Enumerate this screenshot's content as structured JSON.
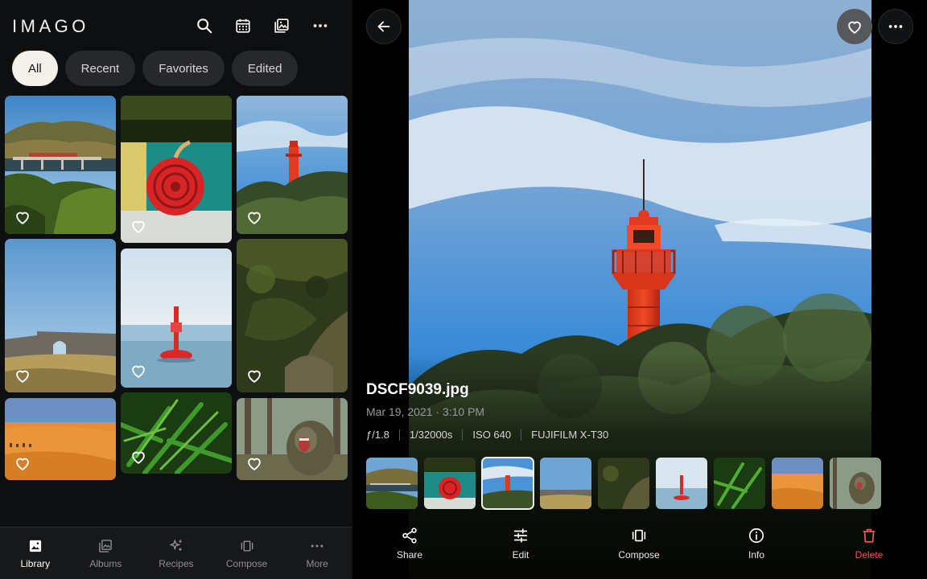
{
  "app": {
    "brand": "IMAGO"
  },
  "header_icons": [
    "search-icon",
    "calendar-icon",
    "gallery-icon",
    "more-icon"
  ],
  "filters": {
    "chips": [
      {
        "label": "All",
        "active": true
      },
      {
        "label": "Recent",
        "active": false
      },
      {
        "label": "Favorites",
        "active": false
      },
      {
        "label": "Edited",
        "active": false
      }
    ]
  },
  "grid": {
    "photos": [
      {
        "subject": "bridge-landscape",
        "favorited": false
      },
      {
        "subject": "red-buoy-overhead",
        "favorited": false
      },
      {
        "subject": "red-lighthouse",
        "favorited": false,
        "selected": true
      },
      {
        "subject": "stone-ruin-arch",
        "favorited": false
      },
      {
        "subject": "red-buoy-sea",
        "favorited": false
      },
      {
        "subject": "rocky-hillside",
        "favorited": false
      },
      {
        "subject": "desert-dunes",
        "favorited": false
      },
      {
        "subject": "green-fern",
        "favorited": false
      },
      {
        "subject": "monkey-forest",
        "favorited": false
      }
    ]
  },
  "bottom_nav": {
    "items": [
      {
        "label": "Library",
        "icon": "library-icon",
        "active": true
      },
      {
        "label": "Albums",
        "icon": "albums-icon",
        "active": false
      },
      {
        "label": "Recipes",
        "icon": "sparkle-icon",
        "active": false
      },
      {
        "label": "Compose",
        "icon": "compose-icon",
        "active": false
      },
      {
        "label": "More",
        "icon": "more-icon",
        "active": false
      }
    ]
  },
  "viewer": {
    "filename": "DSCF9039.jpg",
    "date": "Mar 19, 2021 · 3:10 PM",
    "exif": {
      "aperture": "ƒ/1.8",
      "shutter": "1/32000s",
      "iso": "ISO 640",
      "camera": "FUJIFILM X-T30"
    },
    "is_favorite": true,
    "actions": [
      {
        "label": "Share",
        "icon": "share-icon"
      },
      {
        "label": "Edit",
        "icon": "sliders-icon"
      },
      {
        "label": "Compose",
        "icon": "compose-icon"
      },
      {
        "label": "Info",
        "icon": "info-icon"
      },
      {
        "label": "Delete",
        "icon": "trash-icon",
        "color": "#f05454"
      }
    ]
  },
  "colors": {
    "background": "#000000",
    "panel": "#0e0f10",
    "chip_active": "#f3f1ea",
    "chip": "#26282b",
    "danger": "#f05454",
    "lighthouse_red": "#e23a1f",
    "sky_blue": "#3f8fd6"
  }
}
